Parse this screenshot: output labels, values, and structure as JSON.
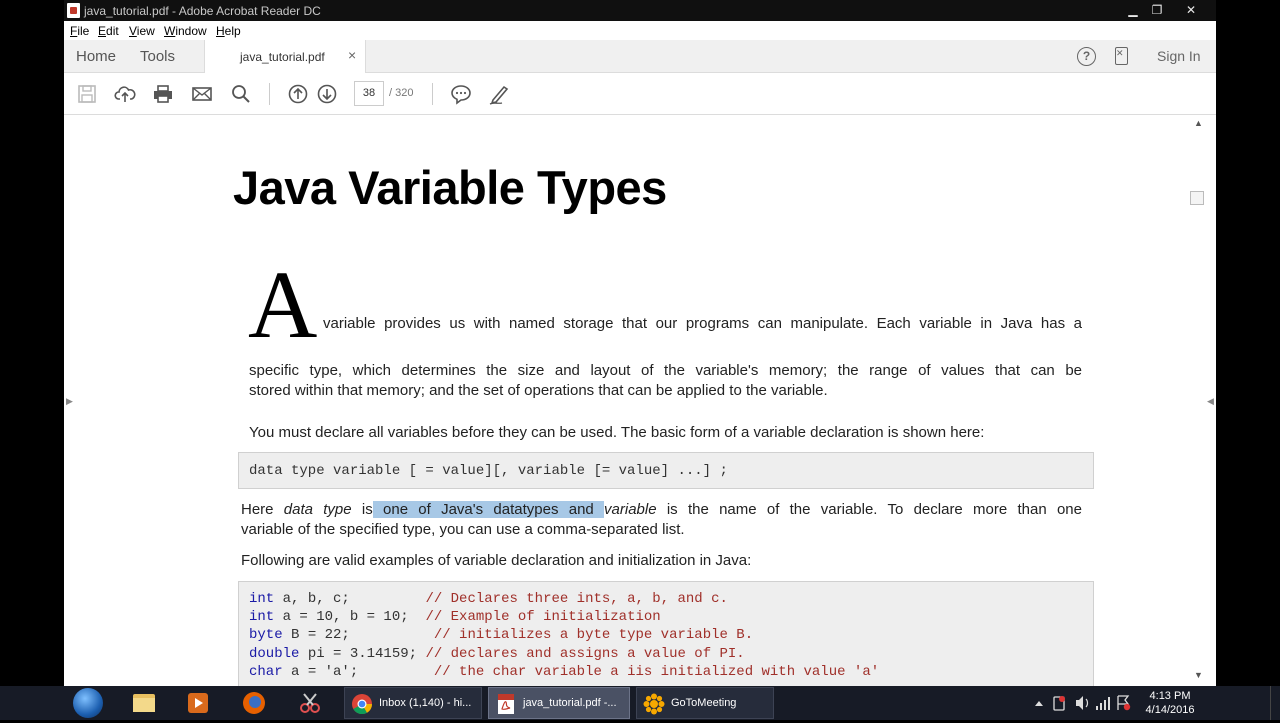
{
  "window": {
    "title": "java_tutorial.pdf - Adobe Acrobat Reader DC",
    "minimize": "▁",
    "maximize": "❐",
    "close": "✕"
  },
  "menu": [
    "File",
    "Edit",
    "View",
    "Window",
    "Help"
  ],
  "tabs": {
    "home": "Home",
    "tools": "Tools",
    "document": "java_tutorial.pdf",
    "close": "×"
  },
  "header_right": {
    "help": "?",
    "signin": "Sign In"
  },
  "toolbar": {
    "page_current": "38",
    "page_total": "/ 320",
    "icons": [
      "save-icon",
      "upload-icon",
      "print-icon",
      "email-icon",
      "search-icon",
      "page-up-icon",
      "page-down-icon",
      "comment-icon",
      "sign-icon"
    ]
  },
  "document": {
    "heading": "Java Variable Types",
    "dropcap": "A",
    "para1_line1": "variable provides us with named storage that our programs can manipulate. Each variable in Java has a",
    "para1_line2": "specific type, which determines the size and layout of the variable's memory; the range of values that can be",
    "para1_line3": "stored within that memory; and the set of operations that can be applied to the variable.",
    "para2": "You must declare all variables before they can be used. The basic form of a variable declaration is shown here:",
    "code1": "data type variable [ = value][, variable [= value] ...] ;",
    "para3": {
      "pre": "Here ",
      "em1": "data type",
      "mid1": " is",
      "highlight": " one of Java's datatypes and ",
      "em2": "variable",
      "rest": " is the name of the variable. To declare more than one",
      "line2": "variable of the specified type, you can use a comma-separated list."
    },
    "para4": "Following are valid examples of variable declaration and initialization in Java:",
    "code2": [
      {
        "kw": "int",
        "code": " a, b, c;         ",
        "comment": "// Declares three ints, a, b, and c."
      },
      {
        "kw": "int",
        "code": " a = 10, b = 10;  ",
        "comment": "// Example of initialization"
      },
      {
        "kw": "byte",
        "code": " B = 22;          ",
        "comment": "// initializes a byte type variable B."
      },
      {
        "kw": "double",
        "code": " pi = 3.14159; ",
        "comment": "// declares and assigns a value of PI."
      },
      {
        "kw": "char",
        "code": " a = 'a';         ",
        "comment": "// the char variable a iis initialized with value 'a'"
      }
    ]
  },
  "taskbar": {
    "tasks": [
      {
        "label": "Inbox (1,140) - hi...",
        "icon": "chrome-icon"
      },
      {
        "label": "java_tutorial.pdf -...",
        "icon": "acrobat-icon"
      },
      {
        "label": "GoToMeeting",
        "icon": "gotomeeting-icon"
      }
    ],
    "time": "4:13 PM",
    "date": "4/14/2016"
  }
}
